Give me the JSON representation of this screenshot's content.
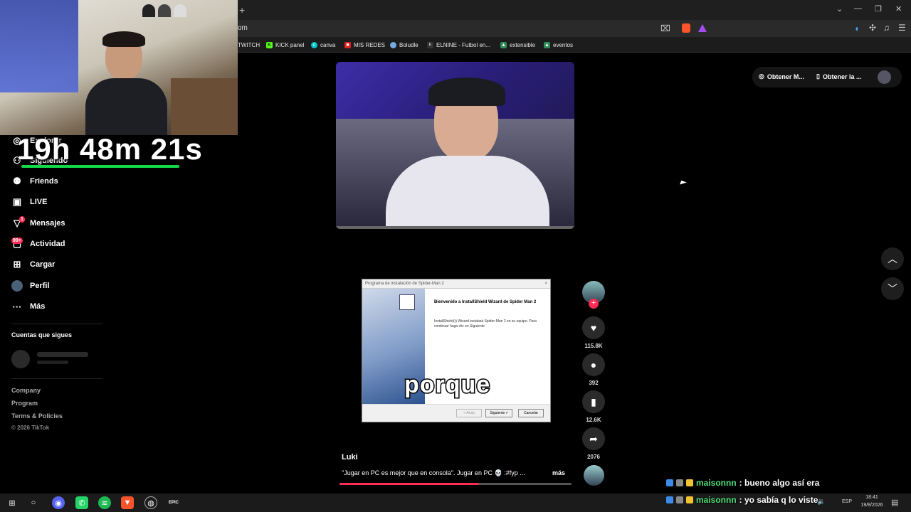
{
  "browser": {
    "url": "om",
    "new_tab": "+",
    "window_controls": [
      "⌄",
      "—",
      "❐",
      "✕"
    ],
    "bookmarks": [
      {
        "label": "TWITCH",
        "icon": "twitch-icon",
        "color": "#9146ff"
      },
      {
        "label": "KICK panel",
        "icon": "kick-icon",
        "color": "#53fc18"
      },
      {
        "label": "canva",
        "icon": "canva-icon",
        "color": "#00c4cc"
      },
      {
        "label": "MIS REDES",
        "icon": "redes-icon",
        "color": "#e02020"
      },
      {
        "label": "Boludle",
        "icon": "boludle-icon",
        "color": "#74acdf"
      },
      {
        "label": "ELNINE - Futbol en...",
        "icon": "elnine-icon",
        "color": "#333333"
      },
      {
        "label": "extensible",
        "icon": "tree-icon",
        "color": "#2e8b57"
      },
      {
        "label": "eventos",
        "icon": "tree-icon",
        "color": "#2e8b57"
      }
    ]
  },
  "overlay": {
    "timer": "19h 48m 21s",
    "timer_bar_color": "#13d84a"
  },
  "sidebar": {
    "items": [
      {
        "label": "Explorar",
        "icon": "compass-icon"
      },
      {
        "label": "Siguiendo",
        "icon": "following-icon"
      },
      {
        "label": "Friends",
        "icon": "friends-icon"
      },
      {
        "label": "LIVE",
        "icon": "live-icon"
      },
      {
        "label": "Mensajes",
        "icon": "messages-icon",
        "badge": "1"
      },
      {
        "label": "Actividad",
        "icon": "activity-icon",
        "badge": "99+"
      },
      {
        "label": "Cargar",
        "icon": "upload-icon"
      },
      {
        "label": "Perfil",
        "icon": "profile-icon"
      },
      {
        "label": "Más",
        "icon": "more-icon"
      }
    ],
    "following_title": "Cuentas que sigues",
    "footer": [
      "Company",
      "Program",
      "Terms & Policies",
      "© 2026 TikTok"
    ]
  },
  "header_actions": {
    "get_app_1": "Obtener M...",
    "get_app_2": "Obtener la ..."
  },
  "video": {
    "caption_overlay": "porque",
    "installer": {
      "window_title": "Programa de instalación de Spider-Man 2",
      "heading": "Bienvenido a InstallShield Wizard de Spider Man 2",
      "body": "InstallShield(r) Wizard instalará Spider-Man 2 en su equipo. Para continuar haga clic en Siguiente",
      "btn_back": "< Atrás",
      "btn_next": "Siguiente >",
      "btn_cancel": "Cancelar"
    },
    "author": "Luki",
    "description": "\"Jugar en PC es mejor que en consola\". Jugar en PC 💀 :#fyp ...",
    "more": "más",
    "progress": 0.6,
    "likes": "115.8K",
    "comments": "392",
    "saves": "12.6K",
    "shares": "2076"
  },
  "chat": [
    {
      "user": "maisonnn",
      "message": ": bueno algo así era"
    },
    {
      "user": "maisonnn",
      "message": ": yo sabía q lo viste"
    }
  ],
  "taskbar": {
    "lang": "ESP",
    "time": "18:41",
    "date": "19/8/2026"
  }
}
